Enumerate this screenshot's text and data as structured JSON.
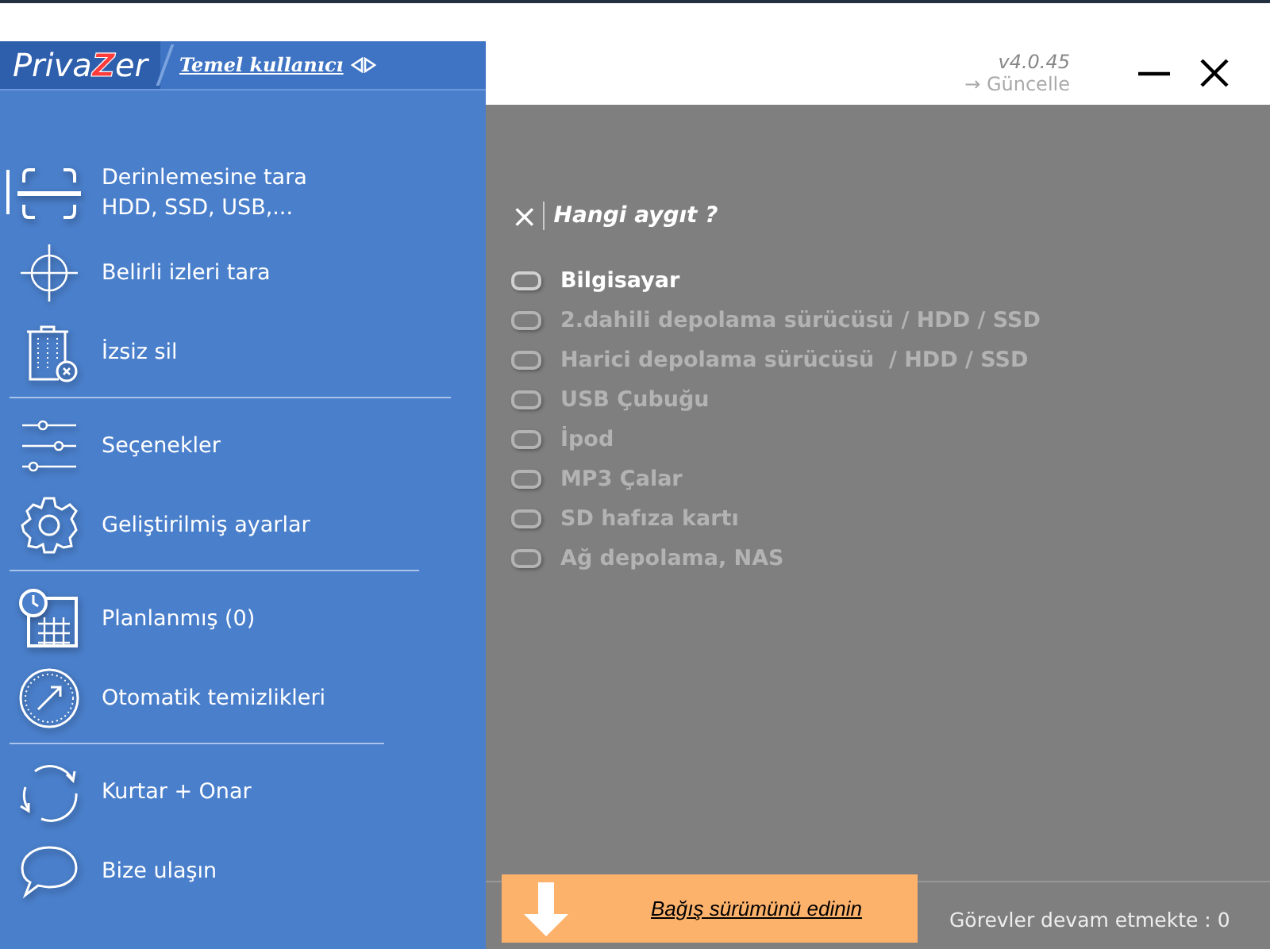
{
  "logo": {
    "before": "Priva",
    "accent": "Z",
    "after": "er"
  },
  "user_mode_link": "Temel kullanıcı",
  "version": "v4.0.45",
  "update_link": "→ Güncelle",
  "sidebar": {
    "groups": [
      {
        "items": [
          {
            "label": "Derinlemesine tara",
            "sublabel": "HDD, SSD, USB,...",
            "selected": true
          },
          {
            "label": "Belirli izleri tara",
            "selected": false
          },
          {
            "label": "İzsiz sil",
            "selected": false
          }
        ]
      },
      {
        "items": [
          {
            "label": "Seçenekler",
            "selected": false
          },
          {
            "label": "Geliştirilmiş ayarlar",
            "selected": false
          }
        ]
      },
      {
        "items": [
          {
            "label": "Planlanmış (0)",
            "selected": false
          },
          {
            "label": "Otomatik temizlikleri",
            "selected": false
          }
        ]
      },
      {
        "items": [
          {
            "label": "Kurtar + Onar",
            "selected": false
          },
          {
            "label": "Bize ulaşın",
            "selected": false
          }
        ]
      }
    ]
  },
  "device_panel": {
    "close": "×",
    "title": "Hangi aygıt ?",
    "devices": [
      {
        "label": "Bilgisayar",
        "selected": true
      },
      {
        "label": "2.dahili depolama sürücüsü / HDD / SSD",
        "selected": false
      },
      {
        "label": "Harici depolama sürücüsü  / HDD / SSD",
        "selected": false
      },
      {
        "label": "USB Çubuğu",
        "selected": false
      },
      {
        "label": "İpod",
        "selected": false
      },
      {
        "label": "MP3 Çalar",
        "selected": false
      },
      {
        "label": "SD hafıza kartı",
        "selected": false
      },
      {
        "label": "Ağ depolama, NAS",
        "selected": false
      }
    ]
  },
  "donate_button": "Bağış sürümünü edinin",
  "status_bar": "Görevler devam etmekte : 0"
}
